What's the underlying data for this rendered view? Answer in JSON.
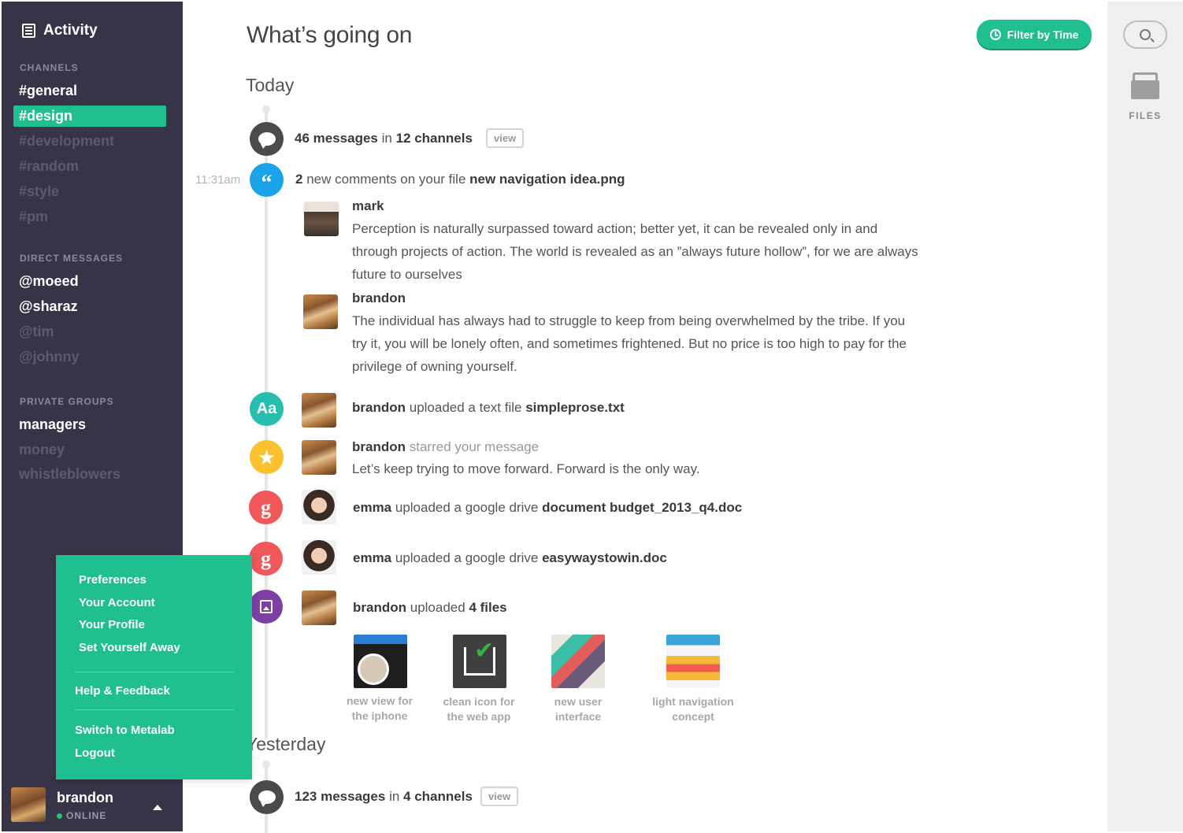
{
  "sidebar": {
    "brand": "Activity",
    "channels_title": "CHANNELS",
    "channels": [
      "#general",
      "#design",
      "#development",
      "#random",
      "#style",
      "#pm"
    ],
    "dm_title": "DIRECT MESSAGES",
    "dms": [
      "@moeed",
      "@sharaz",
      "@tim",
      "@johnny"
    ],
    "groups_title": "PRIVATE GROUPS",
    "groups": [
      "managers",
      "money",
      "whistleblowers"
    ],
    "user": {
      "name": "brandon",
      "status": "ONLINE"
    }
  },
  "menu": {
    "preferences": "Preferences",
    "account": "Your Account",
    "profile": "Your Profile",
    "away": "Set Yourself Away",
    "help": "Help & Feedback",
    "switch": "Switch to Metalab",
    "logout": "Logout"
  },
  "header": {
    "title": "What’s going on",
    "filter": "Filter by Time"
  },
  "today": {
    "title": "Today",
    "summary": {
      "count": "46 messages",
      "in": "in",
      "channels": "12 channels",
      "view": "view"
    },
    "comments": {
      "time": "11:31am",
      "count": "2",
      "text": "new comments on your file",
      "file": "new navigation idea.png",
      "items": [
        {
          "name": "mark",
          "body": "Perception is naturally surpassed toward action; better yet, it can be revealed only in and through projects of action. The world is revealed as an ”always future hollow”, for we are always future to ourselves"
        },
        {
          "name": "brandon",
          "body": "The individual has always had to struggle to keep from being overwhelmed by the tribe. If you try it, you will be lonely often, and sometimes frightened. But no price is too high to pay for the privilege of owning yourself."
        }
      ]
    },
    "text_upload": {
      "icon": "Aa",
      "user": "brandon",
      "action": "uploaded a text file",
      "file": "simpleprose.txt"
    },
    "starred": {
      "user": "brandon",
      "action": "starred your message",
      "quote": "Let’s keep trying to move forward. Forward is the only way."
    },
    "gdrive1": {
      "icon": "g",
      "user": "emma",
      "action": "uploaded a google drive",
      "file": "document budget_2013_q4.doc"
    },
    "gdrive2": {
      "icon": "g",
      "user": "emma",
      "action": "uploaded a google drive",
      "file": "easywaystowin.doc"
    },
    "files_upload": {
      "user": "brandon",
      "action": "uploaded",
      "count": "4 files",
      "files": [
        {
          "line1": "new view for",
          "line2": "the iphone"
        },
        {
          "line1": "clean icon for",
          "line2": "the web app"
        },
        {
          "line1": "new user",
          "line2": "interface"
        },
        {
          "line1": "light navigation",
          "line2": "concept"
        }
      ]
    }
  },
  "yesterday": {
    "title": "Yesterday",
    "summary": {
      "count": "123 messages",
      "in": "in",
      "channels": "4 channels",
      "view": "view"
    }
  },
  "rail": {
    "files_label": "FILES"
  },
  "colors": {
    "sidebar": "#363446",
    "accent": "#1fbf8f",
    "rail": "#f0f0f0"
  }
}
